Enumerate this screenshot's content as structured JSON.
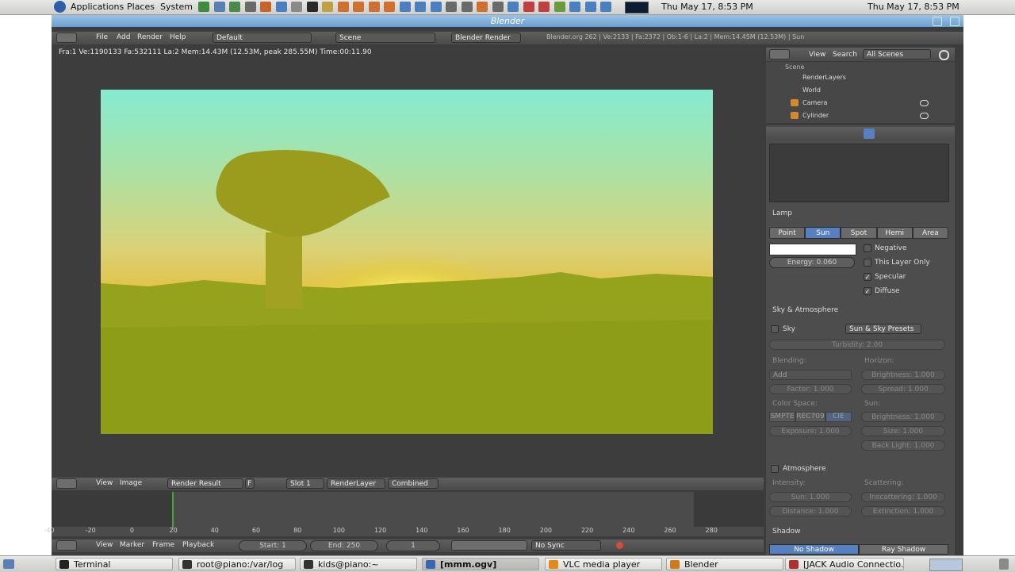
{
  "panel": {
    "menus": [
      "Applications",
      "Places",
      "System"
    ],
    "clock": "Thu May 17,  8:53 PM"
  },
  "window": {
    "title": "Blender"
  },
  "info_header": {
    "menus": [
      "File",
      "Add",
      "Render",
      "Help"
    ],
    "screen": "Default",
    "scene": "Scene",
    "engine": "Blender Render",
    "stats": "Blender.org 262 | Ve:2133 | Fa:2372 | Ob:1-6 | La:2 | Mem:14.45M (12.53M) | Sun"
  },
  "render_stats": "Fra:1  Ve:1190133 Fa:532111 La:2 Mem:14.43M (12.53M, peak 285.55M) Time:00:11.90",
  "image_header": {
    "menus": [
      "View",
      "Image"
    ],
    "image": "Render Result",
    "fake": "F",
    "slot": "Slot 1",
    "layer": "RenderLayer",
    "pass": "Combined"
  },
  "timeline": {
    "ruler": [
      "-40",
      "-20",
      "0",
      "20",
      "40",
      "60",
      "80",
      "100",
      "120",
      "140",
      "160",
      "180",
      "200",
      "220",
      "240",
      "260",
      "280"
    ],
    "menus": [
      "View",
      "Marker",
      "Frame",
      "Playback"
    ],
    "start": "Start: 1",
    "end": "End: 250",
    "current": "1",
    "sync": "No Sync"
  },
  "outliner": {
    "menus": [
      "View",
      "Search"
    ],
    "filter": "All Scenes",
    "items": [
      "Scene",
      "RenderLayers",
      "World",
      "Camera",
      "Cylinder"
    ]
  },
  "properties": {
    "lamp_panel": "Lamp",
    "lamp_types": [
      "Point",
      "Sun",
      "Spot",
      "Hemi",
      "Area"
    ],
    "selected_type": "Sun",
    "energy": "Energy: 0.060",
    "opts": [
      {
        "label": "Negative",
        "checked": false
      },
      {
        "label": "This Layer Only",
        "checked": false
      },
      {
        "label": "Specular",
        "checked": true
      },
      {
        "label": "Diffuse",
        "checked": true
      }
    ],
    "sky_panel": "Sky & Atmosphere",
    "sky": "Sky",
    "sky_presets": "Sun & Sky Presets",
    "turbidity": "Turbidity: 2.00",
    "blending": "Blending:",
    "horizon": "Horizon:",
    "blend_mode": "Add",
    "factor": "Factor: 1.000",
    "h_brightness": "Brightness: 1.000",
    "spread": "Spread: 1.000",
    "color_space": "Color Space:",
    "sun": "Sun:",
    "color_mode": "SMPTE",
    "color_mode2": "REC709",
    "color_mode3": "CIE",
    "exposure": "Exposure: 1.000",
    "s_brightness": "Brightness: 1.000",
    "size": "Size: 1.000",
    "back_light": "Back Light: 1.000",
    "atmosphere": "Atmosphere",
    "intensity": "Intensity:",
    "scattering": "Scattering:",
    "sun_i": "Sun: 1.000",
    "distance": "Distance: 1.000",
    "inscattering": "Inscattering: 1.000",
    "extinction": "Extinction: 1.000",
    "shadow": "Shadow",
    "no_shadow": "No Shadow",
    "ray_shadow": "Ray Shadow"
  },
  "taskbar": [
    {
      "label": "Terminal",
      "active": false
    },
    {
      "label": "root@piano:/var/log",
      "active": false
    },
    {
      "label": "kids@piano:~",
      "active": false
    },
    {
      "label": "[mmm.ogv]",
      "active": true
    },
    {
      "label": "VLC media player",
      "active": false
    },
    {
      "label": "Blender",
      "active": false
    },
    {
      "label": "[JACK Audio Connectio...",
      "active": false
    }
  ]
}
